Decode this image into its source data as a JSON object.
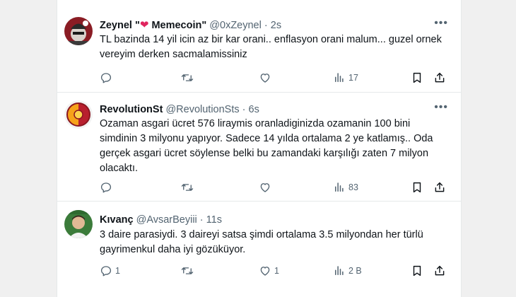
{
  "tweets": [
    {
      "name": "Zeynel \"",
      "name_tail": "Memecoin\"",
      "handle": "@0xZeynel",
      "dot": "·",
      "time": "2s",
      "text": "TL bazinda 14 yil icin az bir kar orani.. enflasyon orani malum... guzel ornek vereyim derken sacmalamissiniz",
      "reply_count": "",
      "retweet_count": "",
      "like_count": "",
      "view_count": "17"
    },
    {
      "name": "RevolutionSt",
      "handle": "@RevolutionSts",
      "dot": "·",
      "time": "6s",
      "text": "Ozaman asgari ücret 576 liraymis oranladiginizda ozamanin 100 bini simdinin 3 milyonu yapıyor. Sadece 14 yılda ortalama 2 ye katlamış.. Oda gerçek asgari ücret söylense belki bu zamandaki karşılığı zaten 7 milyon olacaktı.",
      "reply_count": "",
      "retweet_count": "",
      "like_count": "",
      "view_count": "83"
    },
    {
      "name": "Kıvanç",
      "handle": "@AvsarBeyiii",
      "dot": "·",
      "time": "11s",
      "text": "3 daire parasiydi. 3 daireyi satsa şimdi ortalama 3.5 milyondan her türlü gayrimenkul daha iyi gözüküyor.",
      "reply_count": "1",
      "retweet_count": "",
      "like_count": "1",
      "view_count": "2 B"
    }
  ],
  "colors": {
    "text": "#0f1419",
    "secondary": "#536471",
    "heart": "#e0245e",
    "border": "#e6e9ea",
    "background": "#ffffff"
  },
  "icons": [
    "more-icon",
    "reply-icon",
    "retweet-icon",
    "like-icon",
    "views-icon",
    "bookmark-icon",
    "share-icon",
    "heart-icon"
  ]
}
